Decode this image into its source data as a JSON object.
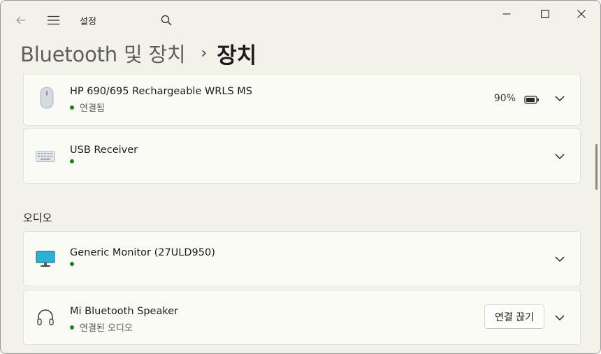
{
  "titlebar": {
    "app_title": "설정"
  },
  "breadcrumb": {
    "parent": "Bluetooth 및 장치",
    "separator": "›",
    "current": "장치"
  },
  "devices": [
    {
      "name": "HP 690/695 Rechargeable WRLS MS",
      "status": "연결됨",
      "icon": "mouse-icon",
      "battery": "90%"
    },
    {
      "name": "USB Receiver",
      "status": "",
      "icon": "keyboard-icon"
    }
  ],
  "audio": {
    "section_title": "오디오",
    "devices": [
      {
        "name": "Generic Monitor (27ULD950)",
        "status": "",
        "icon": "monitor-icon"
      },
      {
        "name": "Mi Bluetooth Speaker",
        "status": "연결된 오디오",
        "icon": "headphones-icon",
        "action_label": "연결 끊기"
      }
    ]
  },
  "colors": {
    "window_bg": "#f3f2e8",
    "card_bg": "#fbfbf6",
    "status_green": "#108a17"
  }
}
